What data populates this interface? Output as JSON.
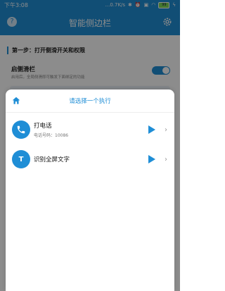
{
  "status": {
    "time": "下午3:08",
    "network_speed": "...0.7K/s",
    "battery": "99"
  },
  "header": {
    "title": "智能侧边栏",
    "help_symbol": "?"
  },
  "background": {
    "step_title": "第一步：打开侧滑开关和权限",
    "toggle_label": "启侧滑栏",
    "toggle_desc": "启用后，全局侧滑即可触发下面绑定的功能"
  },
  "sheet": {
    "title": "请选择一个执行",
    "actions": [
      {
        "name": "打电话",
        "subtitle": "电话号码：10086",
        "icon": "phone-icon"
      },
      {
        "name": "识别全屏文字",
        "subtitle": "",
        "icon": "text-recognition-icon",
        "icon_glyph": "T"
      }
    ]
  },
  "colors": {
    "accent": "#1f8ed6"
  }
}
